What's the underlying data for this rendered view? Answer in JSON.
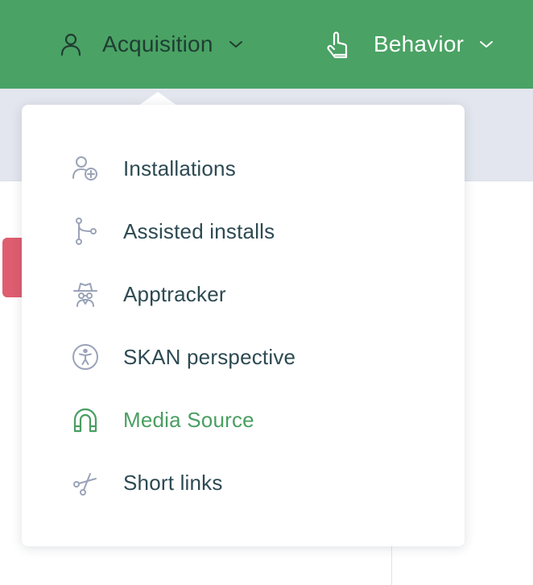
{
  "colors": {
    "topbar_bg": "#4aa264",
    "subbar_bg": "#e3e6ee",
    "active_text": "#4a9e62",
    "menu_text": "#2d4a52",
    "icon_gray": "#9aa3b8",
    "badge_red": "#de5e70"
  },
  "topnav": {
    "acquisition": {
      "label": "Acquisition",
      "icon": "user-icon",
      "expanded": true
    },
    "behavior": {
      "label": "Behavior",
      "icon": "hand-pointer-icon",
      "expanded": false
    }
  },
  "dropdown": {
    "items": [
      {
        "label": "Installations",
        "icon": "user-plus-icon",
        "active": false
      },
      {
        "label": "Assisted installs",
        "icon": "branch-icon",
        "active": false
      },
      {
        "label": "Apptracker",
        "icon": "spy-icon",
        "active": false
      },
      {
        "label": "SKAN perspective",
        "icon": "accessibility-icon",
        "active": false
      },
      {
        "label": "Media Source",
        "icon": "magnet-icon",
        "active": true
      },
      {
        "label": "Short links",
        "icon": "scissors-icon",
        "active": false
      }
    ]
  }
}
